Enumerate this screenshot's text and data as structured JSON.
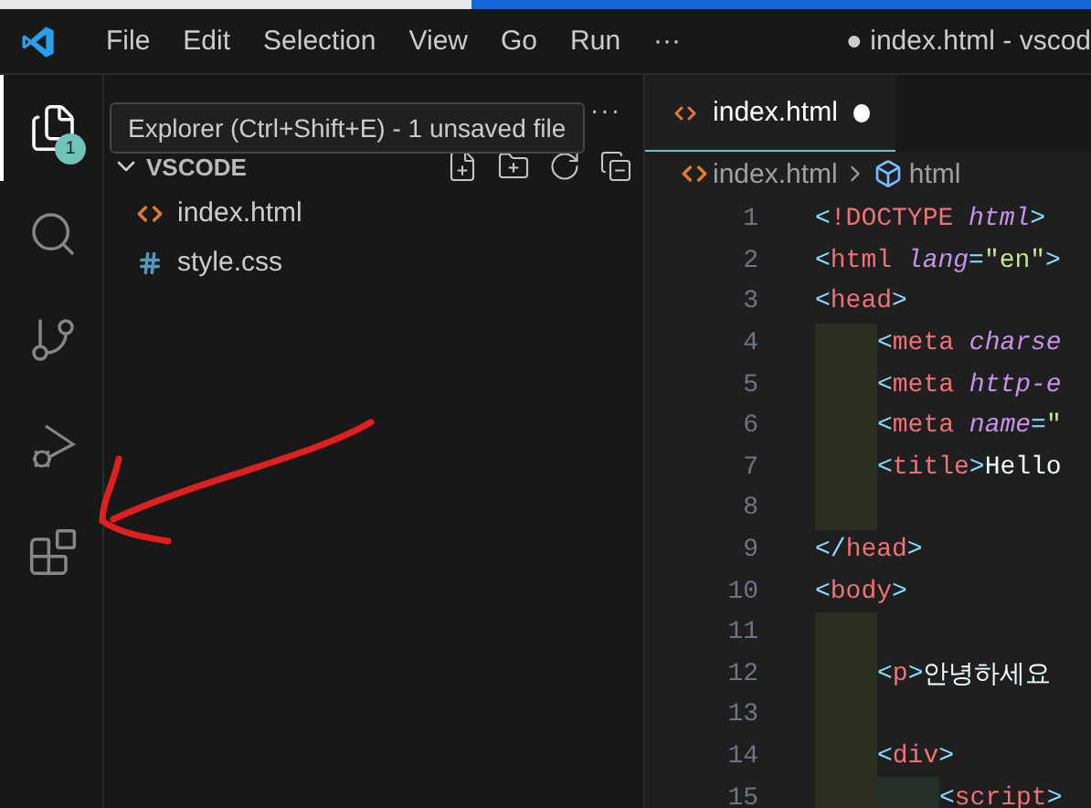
{
  "window": {
    "title": "● index.html - vscod"
  },
  "menu": [
    "File",
    "Edit",
    "Selection",
    "View",
    "Go",
    "Run",
    "···"
  ],
  "activity_bar": [
    {
      "kind": "explorer",
      "selected": true,
      "badge": "1"
    },
    {
      "kind": "search",
      "selected": false
    },
    {
      "kind": "source-control",
      "selected": false
    },
    {
      "kind": "run-debug",
      "selected": false
    },
    {
      "kind": "extensions",
      "selected": false
    }
  ],
  "tooltip": "Explorer (Ctrl+Shift+E) - 1 unsaved file",
  "sidebar": {
    "more": "···",
    "folder": {
      "name": "VSCODE",
      "expanded": true,
      "children": [
        {
          "name": "index.html",
          "kind": "html"
        },
        {
          "name": "style.css",
          "kind": "css"
        }
      ]
    }
  },
  "tabs": [
    {
      "label": "index.html",
      "selected": true,
      "modified": true
    }
  ],
  "breadcrumb": [
    {
      "label": "index.html",
      "kind": "file"
    },
    {
      "label": "html",
      "kind": "element"
    }
  ],
  "code": [
    {
      "number": "1",
      "tokens": [
        {
          "kind": "bracket",
          "text": "<"
        },
        {
          "kind": "tag",
          "text": "!DOCTYPE"
        },
        {
          "kind": "attr",
          "text": " html"
        },
        {
          "kind": "bracket",
          "text": ">"
        }
      ]
    },
    {
      "number": "2",
      "tokens": [
        {
          "kind": "bracket",
          "text": "<"
        },
        {
          "kind": "tag",
          "text": "html"
        },
        {
          "kind": "attr",
          "text": " lang"
        },
        {
          "kind": "bracket",
          "text": "="
        },
        {
          "kind": "string",
          "text": "\"en\""
        },
        {
          "kind": "bracket",
          "text": ">"
        }
      ]
    },
    {
      "number": "3",
      "tokens": [
        {
          "kind": "bracket",
          "text": "<"
        },
        {
          "kind": "tag",
          "text": "head"
        },
        {
          "kind": "bracket",
          "text": ">"
        }
      ],
      "children": [
        {
          "number": "4",
          "tokens": [
            {
              "kind": "bracket",
              "text": "<"
            },
            {
              "kind": "tag",
              "text": "meta"
            },
            {
              "kind": "attr",
              "text": " charse"
            }
          ]
        },
        {
          "number": "5",
          "tokens": [
            {
              "kind": "bracket",
              "text": "<"
            },
            {
              "kind": "tag",
              "text": "meta"
            },
            {
              "kind": "attr",
              "text": " http-e"
            }
          ]
        },
        {
          "number": "6",
          "tokens": [
            {
              "kind": "bracket",
              "text": "<"
            },
            {
              "kind": "tag",
              "text": "meta"
            },
            {
              "kind": "attr",
              "text": " name"
            },
            {
              "kind": "bracket",
              "text": "="
            },
            {
              "kind": "string",
              "text": "\""
            }
          ]
        },
        {
          "number": "7",
          "tokens": [
            {
              "kind": "bracket",
              "text": "<"
            },
            {
              "kind": "tag",
              "text": "title"
            },
            {
              "kind": "bracket",
              "text": ">"
            },
            {
              "kind": "text",
              "text": "Hello"
            }
          ]
        },
        {
          "number": "8"
        }
      ]
    },
    {
      "number": "9",
      "tokens": [
        {
          "kind": "bracket",
          "text": "</"
        },
        {
          "kind": "tag",
          "text": "head"
        },
        {
          "kind": "bracket",
          "text": ">"
        }
      ]
    },
    {
      "number": "10",
      "tokens": [
        {
          "kind": "bracket",
          "text": "<"
        },
        {
          "kind": "tag",
          "text": "body"
        },
        {
          "kind": "bracket",
          "text": ">"
        }
      ],
      "children": [
        {
          "number": "11"
        },
        {
          "number": "12",
          "tokens": [
            {
              "kind": "bracket",
              "text": "<"
            },
            {
              "kind": "tag",
              "text": "p"
            },
            {
              "kind": "bracket",
              "text": ">"
            },
            {
              "kind": "text",
              "text": "안녕하세요"
            }
          ]
        },
        {
          "number": "13"
        },
        {
          "number": "14",
          "tokens": [
            {
              "kind": "bracket",
              "text": "<"
            },
            {
              "kind": "tag",
              "text": "div"
            },
            {
              "kind": "bracket",
              "text": ">"
            }
          ],
          "children": [
            {
              "number": "15",
              "tokens": [
                {
                  "kind": "bracket",
                  "text": "<"
                },
                {
                  "kind": "tag",
                  "text": "script"
                },
                {
                  "kind": "bracket",
                  "text": ">"
                }
              ]
            }
          ]
        }
      ]
    }
  ]
}
